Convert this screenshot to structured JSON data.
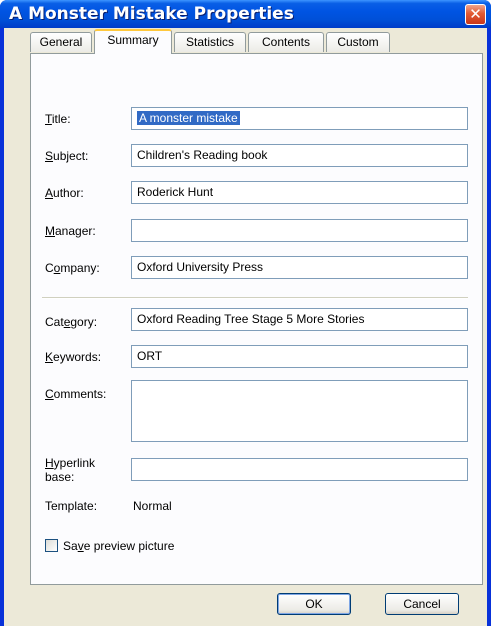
{
  "window": {
    "title": "A Monster Mistake Properties",
    "close_glyph": "✕"
  },
  "tabs": [
    {
      "label": "General",
      "active": false
    },
    {
      "label": "Summary",
      "active": true
    },
    {
      "label": "Statistics",
      "active": false
    },
    {
      "label": "Contents",
      "active": false
    },
    {
      "label": "Custom",
      "active": false
    }
  ],
  "fields": {
    "title": {
      "label_u": "T",
      "label_rest": "itle:",
      "value": "A monster mistake"
    },
    "subject": {
      "label_u": "S",
      "label_rest": "ubject:",
      "value": "Children's Reading book"
    },
    "author": {
      "label_u": "A",
      "label_rest": "uthor:",
      "value": "Roderick Hunt"
    },
    "manager": {
      "label_u": "M",
      "label_rest": "anager:",
      "value": ""
    },
    "company": {
      "label_pre": "C",
      "label_u": "o",
      "label_rest": "mpany:",
      "value": "Oxford University Press"
    },
    "category": {
      "label_pre": "Cat",
      "label_u": "e",
      "label_rest": "gory:",
      "value": "Oxford Reading Tree Stage 5 More Stories"
    },
    "keywords": {
      "label_u": "K",
      "label_rest": "eywords:",
      "value": "ORT"
    },
    "comments": {
      "label_u": "C",
      "label_rest": "omments:",
      "value": ""
    },
    "hyperlink": {
      "label_u": "H",
      "label_rest1": "yperlink",
      "label_line2": "base:",
      "value": ""
    },
    "template": {
      "label": "Template:",
      "value": "Normal"
    }
  },
  "save_preview": {
    "label_pre": "Sa",
    "label_u": "v",
    "label_rest": "e preview picture",
    "checked": false
  },
  "buttons": {
    "ok": "OK",
    "cancel": "Cancel"
  },
  "colors": {
    "titlebar": "#0054e3",
    "client": "#ece9d8",
    "selection": "#316ac5",
    "active_tab_accent": "#ffc83c"
  }
}
